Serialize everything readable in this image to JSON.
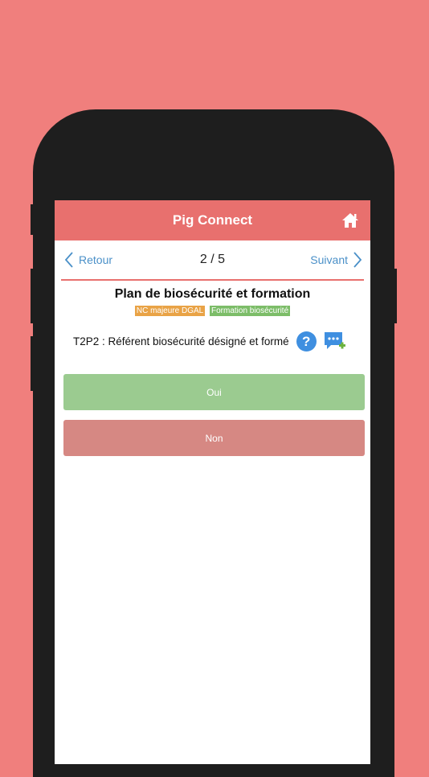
{
  "header": {
    "title": "Pig Connect",
    "home_icon": "home-icon"
  },
  "nav": {
    "back_label": "Retour",
    "counter": "2 / 5",
    "next_label": "Suivant"
  },
  "section": {
    "title": "Plan de biosécurité et formation",
    "tags": [
      {
        "label": "NC majeure DGAL",
        "color": "#e9a346"
      },
      {
        "label": "Formation biosécurité",
        "color": "#7cbd68"
      }
    ]
  },
  "question": {
    "text": "T2P2 : Référent biosécurité désigné et formé",
    "help_symbol": "?"
  },
  "answers": {
    "yes_label": "Oui",
    "no_label": "Non"
  },
  "colors": {
    "background": "#f07f7d",
    "header": "#e8706e",
    "link": "#4a90c8",
    "yes": "#9bcb90",
    "no": "#d68883"
  }
}
